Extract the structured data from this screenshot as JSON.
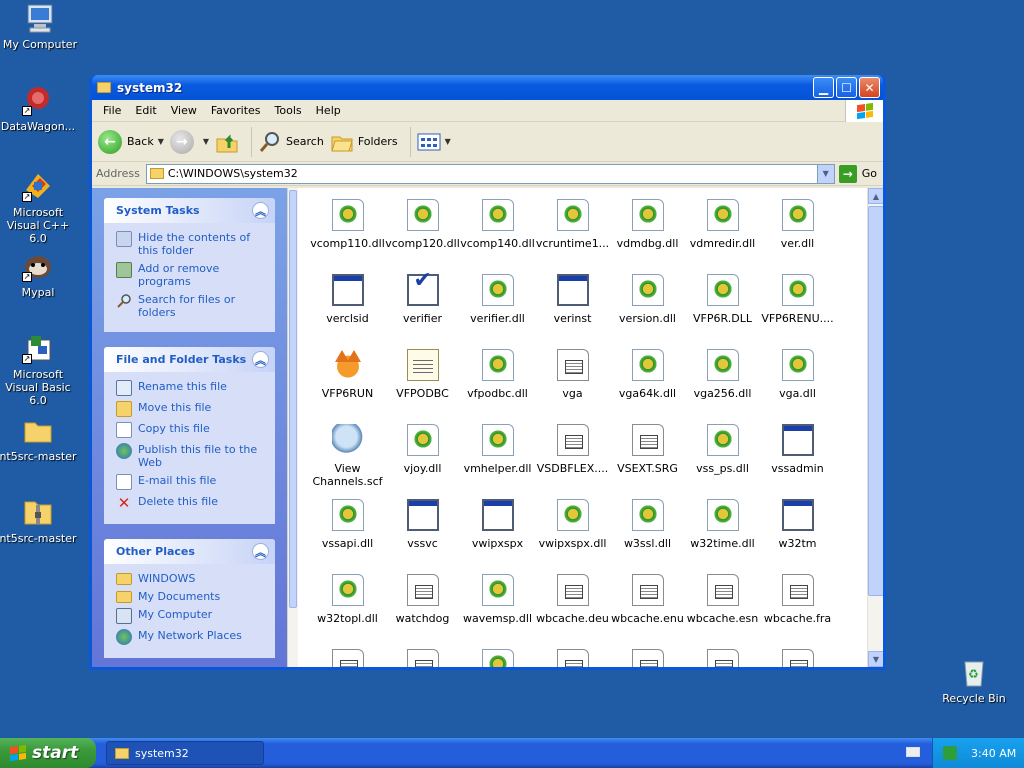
{
  "desktop": {
    "icons": [
      {
        "label": "My Computer",
        "icon": "my-computer-icon"
      },
      {
        "label": "DataWagon...",
        "icon": "datawagon-icon"
      },
      {
        "label": "Microsoft Visual C++ 6.0",
        "icon": "visual-cpp-icon"
      },
      {
        "label": "Mypal",
        "icon": "mypal-icon"
      },
      {
        "label": "Microsoft Visual Basic 6.0",
        "icon": "visual-basic-icon"
      },
      {
        "label": "nt5src-master",
        "icon": "folder-icon"
      },
      {
        "label": "nt5src-master",
        "icon": "zip-folder-icon"
      },
      {
        "label": "Recycle Bin",
        "icon": "recycle-bin-icon"
      }
    ]
  },
  "window": {
    "title": "system32",
    "menu": [
      "File",
      "Edit",
      "View",
      "Favorites",
      "Tools",
      "Help"
    ],
    "toolbar": {
      "back": "Back",
      "search": "Search",
      "folders": "Folders"
    },
    "address": {
      "label": "Address",
      "value": "C:\\WINDOWS\\system32",
      "go": "Go"
    }
  },
  "tasks": {
    "system": {
      "title": "System Tasks",
      "items": [
        "Hide the contents of this folder",
        "Add or remove programs",
        "Search for files or folders"
      ]
    },
    "file_folder": {
      "title": "File and Folder Tasks",
      "items": [
        "Rename this file",
        "Move this file",
        "Copy this file",
        "Publish this file to the Web",
        "E-mail this file",
        "Delete this file"
      ]
    },
    "other": {
      "title": "Other Places",
      "items": [
        "WINDOWS",
        "My Documents",
        "My Computer",
        "My Network Places"
      ]
    }
  },
  "files": [
    {
      "name": "vcomp110.dll",
      "type": "dll"
    },
    {
      "name": "vcomp120.dll",
      "type": "dll"
    },
    {
      "name": "vcomp140.dll",
      "type": "dll"
    },
    {
      "name": "vcruntime1...",
      "type": "dll"
    },
    {
      "name": "vdmdbg.dll",
      "type": "dll"
    },
    {
      "name": "vdmredir.dll",
      "type": "dll"
    },
    {
      "name": "ver.dll",
      "type": "dll"
    },
    {
      "name": "verclsid",
      "type": "app"
    },
    {
      "name": "verifier",
      "type": "check"
    },
    {
      "name": "verifier.dll",
      "type": "dll"
    },
    {
      "name": "verinst",
      "type": "app"
    },
    {
      "name": "version.dll",
      "type": "dll"
    },
    {
      "name": "VFP6R.DLL",
      "type": "dll"
    },
    {
      "name": "VFP6RENU....",
      "type": "dll"
    },
    {
      "name": "VFP6RUN",
      "type": "fox"
    },
    {
      "name": "VFPODBC",
      "type": "note"
    },
    {
      "name": "vfpodbc.dll",
      "type": "dll"
    },
    {
      "name": "vga",
      "type": "doc"
    },
    {
      "name": "vga64k.dll",
      "type": "dll"
    },
    {
      "name": "vga256.dll",
      "type": "dll"
    },
    {
      "name": "vga.dll",
      "type": "dll"
    },
    {
      "name": "View Channels.scf",
      "type": "dish"
    },
    {
      "name": "vjoy.dll",
      "type": "dll"
    },
    {
      "name": "vmhelper.dll",
      "type": "dll"
    },
    {
      "name": "VSDBFLEX....",
      "type": "doc"
    },
    {
      "name": "VSEXT.SRG",
      "type": "doc"
    },
    {
      "name": "vss_ps.dll",
      "type": "dll"
    },
    {
      "name": "vssadmin",
      "type": "app"
    },
    {
      "name": "vssapi.dll",
      "type": "dll"
    },
    {
      "name": "vssvc",
      "type": "app"
    },
    {
      "name": "vwipxspx",
      "type": "app"
    },
    {
      "name": "vwipxspx.dll",
      "type": "dll"
    },
    {
      "name": "w3ssl.dll",
      "type": "dll"
    },
    {
      "name": "w32time.dll",
      "type": "dll"
    },
    {
      "name": "w32tm",
      "type": "app"
    },
    {
      "name": "w32topl.dll",
      "type": "dll"
    },
    {
      "name": "watchdog",
      "type": "doc"
    },
    {
      "name": "wavemsp.dll",
      "type": "dll"
    },
    {
      "name": "wbcache.deu",
      "type": "doc"
    },
    {
      "name": "wbcache.enu",
      "type": "doc"
    },
    {
      "name": "wbcache.esn",
      "type": "doc"
    },
    {
      "name": "wbcache.fra",
      "type": "doc"
    },
    {
      "name": "",
      "type": "doc"
    },
    {
      "name": "",
      "type": "doc"
    },
    {
      "name": "",
      "type": "dll"
    },
    {
      "name": "",
      "type": "doc"
    },
    {
      "name": "",
      "type": "doc"
    },
    {
      "name": "",
      "type": "doc"
    },
    {
      "name": "",
      "type": "doc"
    }
  ],
  "taskbar": {
    "start": "start",
    "window_button": "system32",
    "clock": "3:40 AM"
  }
}
